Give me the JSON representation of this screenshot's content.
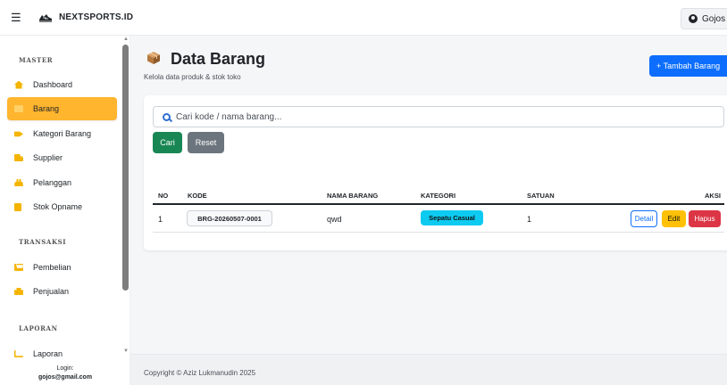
{
  "navbar": {
    "menu_icon": "hamburger-icon",
    "brand_icon": "sneaker-icon",
    "brand": "NEXTSPORTS.ID",
    "user_icon": "user-circle-icon",
    "user": "Gojos"
  },
  "sidebar": {
    "sections": {
      "master": "MASTER",
      "transaksi": "TRANSAKSI",
      "laporan": "LAPORAN"
    },
    "items": [
      {
        "label": "Dashboard",
        "icon": "home-icon"
      },
      {
        "label": "Barang",
        "icon": "box-icon",
        "active": true
      },
      {
        "label": "Kategori Barang",
        "icon": "tag-icon"
      },
      {
        "label": "Supplier",
        "icon": "truck-icon"
      },
      {
        "label": "Pelanggan",
        "icon": "users-icon"
      },
      {
        "label": "Stok Opname",
        "icon": "clipboard-icon"
      },
      {
        "label": "Pembelian",
        "icon": "cart-icon"
      },
      {
        "label": "Penjualan",
        "icon": "shopping-bag-icon"
      },
      {
        "label": "Laporan",
        "icon": "chart-icon"
      }
    ],
    "login_label": "Login:",
    "login_email": "gojos@gmail.com"
  },
  "header": {
    "title_icon": "package-icon",
    "title": "Data Barang",
    "subtitle": "Kelola data produk & stok toko",
    "add_button": "+ Tambah Barang"
  },
  "search": {
    "icon": "search-icon",
    "placeholder": "Cari kode / nama barang...",
    "search_button": "Cari",
    "reset_button": "Reset"
  },
  "table": {
    "headers": {
      "no": "NO",
      "kode": "KODE",
      "nama": "NAMA BARANG",
      "kategori": "KATEGORI",
      "satuan": "SATUAN",
      "aksi": "AKSI"
    },
    "rows": [
      {
        "no": "1",
        "kode": "BRG-20260507-0001",
        "nama": "qwd",
        "kategori": "Sepatu Casual",
        "satuan": "1",
        "detail": "Detail",
        "edit": "Edit",
        "hapus": "Hapus"
      }
    ]
  },
  "footer": {
    "copyright": "Copyright © Aziz Lukmanudin 2025"
  },
  "colors": {
    "active_item": "#ffb52e",
    "primary": "#0d6efd",
    "success": "#198754",
    "secondary": "#6c757d",
    "info": "#0dcaf0",
    "warning": "#ffc107",
    "danger": "#dc3545"
  }
}
